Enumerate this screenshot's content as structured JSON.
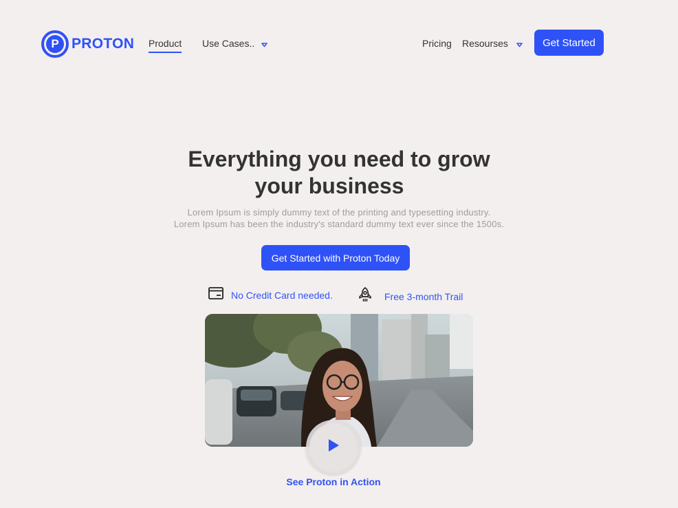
{
  "brand": {
    "name": "PROTON",
    "mark": "P"
  },
  "nav": {
    "product": "Product",
    "use_cases": "Use Cases..",
    "pricing": "Pricing",
    "resources": "Resourses",
    "cta": "Get Started",
    "caret_icon": "chevron-down-icon"
  },
  "hero": {
    "title_line1": "Everything you need to grow",
    "title_line2": "your business",
    "subtitle_line1": "Lorem Ipsum is simply dummy text of the printing and typesetting industry.",
    "subtitle_line2": "Lorem Ipsum has been the industry's standard dummy text ever since the 1500s.",
    "cta": "Get Started with Proton Today"
  },
  "features": [
    {
      "icon": "credit-card-icon",
      "label": "No Credit Card needed."
    },
    {
      "icon": "rocket-icon",
      "label": "Free 3-month Trail"
    }
  ],
  "video": {
    "play_icon": "play-icon",
    "caption": "See Proton in Action"
  },
  "colors": {
    "accent": "#2f52f6",
    "background": "#f3efef",
    "text": "#333333",
    "muted": "#9c9c9c"
  }
}
